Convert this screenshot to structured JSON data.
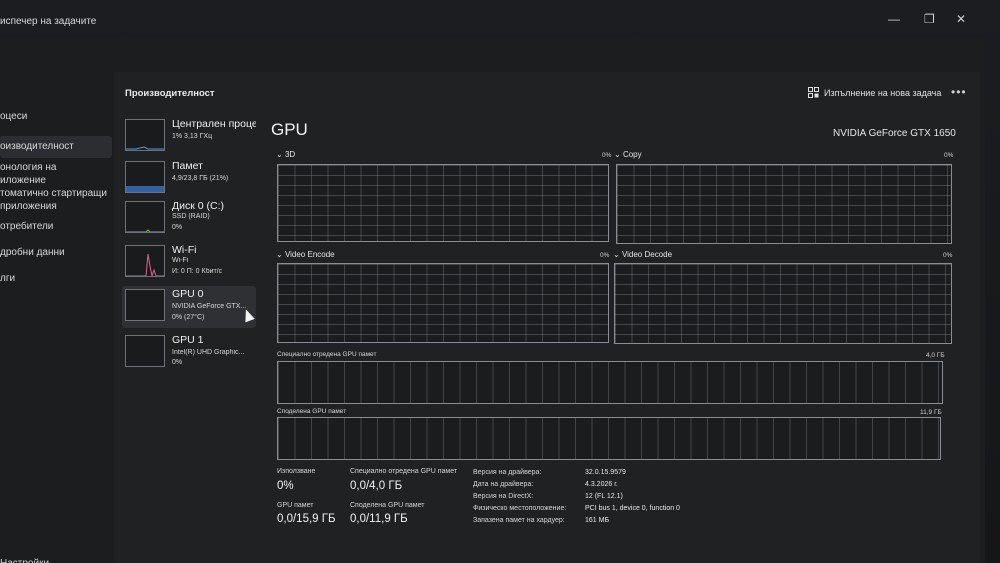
{
  "window": {
    "title": "Диспечер на задачите",
    "title_visible": "испечер на задачите",
    "minimize": "—",
    "maximize": "❐",
    "close": "✕"
  },
  "nav": {
    "items": [
      {
        "label": "оцеси"
      },
      {
        "label": "оизводителност",
        "active": true
      },
      {
        "label": "онология на"
      },
      {
        "label": "иложение"
      },
      {
        "label": "томатично стартиращи"
      },
      {
        "label": "приложения"
      },
      {
        "label": "отребители"
      },
      {
        "label": "дробни данни"
      },
      {
        "label": "лги"
      }
    ],
    "settings": "Настройки"
  },
  "header": {
    "title": "Производителност",
    "new_task": "Изпълнение на нова задача",
    "more": "•••"
  },
  "devices": [
    {
      "title": "Централен проце",
      "sub1": "1% 3,13 ГХц",
      "sub2": ""
    },
    {
      "title": "Памет",
      "sub1": "4,9/23,8 ГБ (21%)",
      "sub2": ""
    },
    {
      "title": "Диск 0 (C:)",
      "sub1": "SSD (RAID)",
      "sub2": "0%"
    },
    {
      "title": "Wi-Fi",
      "sub1": "Wi-Fi",
      "sub2": "И: 0 П: 0 Кбит/с"
    },
    {
      "title": "GPU 0",
      "sub1": "NVIDIA GeForce GTX...",
      "sub2": "0% (27°C)"
    },
    {
      "title": "GPU 1",
      "sub1": "Intel(R) UHD Graphic...",
      "sub2": "0%"
    }
  ],
  "gpu": {
    "title": "GPU",
    "name": "NVIDIA GeForce GTX 1650",
    "graphs": [
      {
        "label": "3D",
        "pct": "0%"
      },
      {
        "label": "Copy",
        "pct": "0%"
      },
      {
        "label": "Video Encode",
        "pct": "0%"
      },
      {
        "label": "Video Decode",
        "pct": "0%"
      }
    ],
    "dedicated_label": "Специално отредена GPU памет",
    "dedicated_max": "4,0 ГБ",
    "shared_label": "Споделена GPU памет",
    "shared_max": "11,9 ГБ"
  },
  "stats": {
    "usage_label": "Използване",
    "usage_value": "0%",
    "dedicated_label": "Специално отредена GPU памет",
    "dedicated_value": "0,0/4,0 ГБ",
    "gpu_mem_label": "GPU памет",
    "gpu_mem_value": "0,0/15,9 ГБ",
    "shared_label": "Споделена GPU памет",
    "shared_value": "0,0/11,9 ГБ"
  },
  "info": [
    {
      "key": "Версия на драйвера:",
      "val": "32.0.15.9579"
    },
    {
      "key": "Дата на драйвера:",
      "val": "4.3.2026 г."
    },
    {
      "key": "Версия на DirectX:",
      "val": "12 (FL 12.1)"
    },
    {
      "key": "Физическо местоположение:",
      "val": "PCI bus 1, device 0, function 0"
    },
    {
      "key": "Запазена памет на хардуер:",
      "val": "161 МБ"
    }
  ]
}
